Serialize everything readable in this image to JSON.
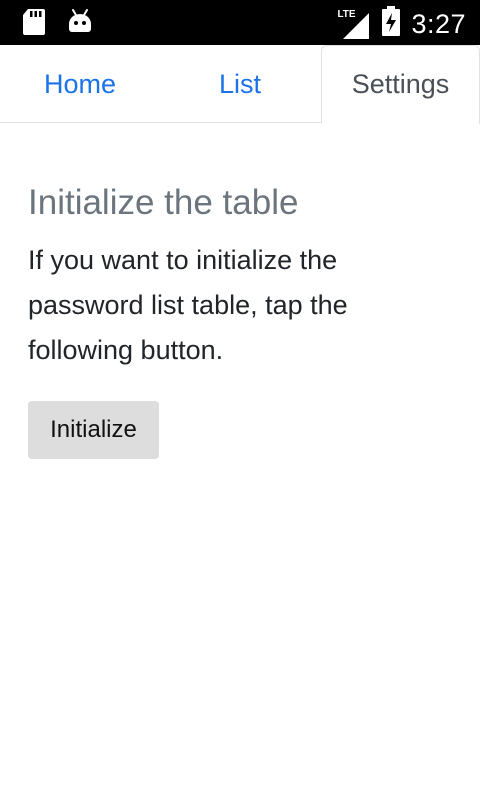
{
  "status_bar": {
    "time": "3:27",
    "network_label": "LTE",
    "icons": [
      "sd-card-icon",
      "android-icon",
      "signal-icon",
      "battery-icon"
    ]
  },
  "tabs": [
    {
      "label": "Home",
      "active": false
    },
    {
      "label": "List",
      "active": false
    },
    {
      "label": "Settings",
      "active": true
    }
  ],
  "settings": {
    "heading": "Initialize the table",
    "description": "If you want to initialize the password list table, tap the following button.",
    "button_label": "Initialize"
  },
  "colors": {
    "link": "#1a73e8",
    "active_tab_text": "#495057",
    "heading": "#6c757d",
    "button_bg": "#dddddd"
  }
}
